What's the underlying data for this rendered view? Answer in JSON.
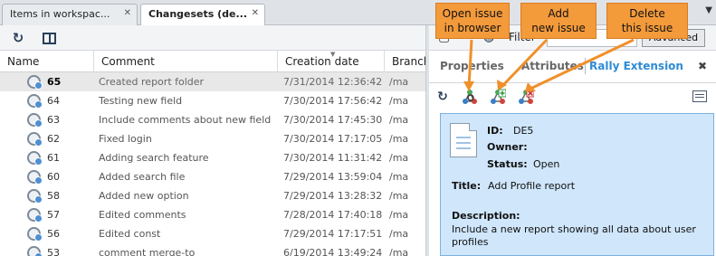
{
  "tabs": [
    {
      "label": "Items in workspac...",
      "close": "✕"
    },
    {
      "label": "Changesets (de...",
      "close": "✕"
    }
  ],
  "tabs_overflow_icon": "chevron-down-icon",
  "toolbar": {
    "refresh_icon": "refresh-icon",
    "panel_icon": "toggle-panel-icon"
  },
  "table": {
    "columns": [
      "Name",
      "Comment",
      "Creation date",
      "Branch"
    ],
    "rows": [
      {
        "id": "65",
        "comment": "Created report folder",
        "date": "7/31/2014 12:36:42",
        "branch": "/ma",
        "selected": true
      },
      {
        "id": "64",
        "comment": "Testing new field",
        "date": "7/30/2014 17:56:42",
        "branch": "/ma"
      },
      {
        "id": "63",
        "comment": "Include comments about new field",
        "date": "7/30/2014 17:45:30",
        "branch": "/ma"
      },
      {
        "id": "62",
        "comment": "Fixed login",
        "date": "7/30/2014 17:17:05",
        "branch": "/ma"
      },
      {
        "id": "61",
        "comment": "Adding search feature",
        "date": "7/30/2014 11:31:42",
        "branch": "/ma"
      },
      {
        "id": "60",
        "comment": "Added search file",
        "date": "7/29/2014 13:59:04",
        "branch": "/ma"
      },
      {
        "id": "58",
        "comment": "Added new option",
        "date": "7/29/2014 13:28:32",
        "branch": "/ma"
      },
      {
        "id": "57",
        "comment": "Edited comments",
        "date": "7/28/2014 17:40:18",
        "branch": "/ma"
      },
      {
        "id": "56",
        "comment": "Edited const",
        "date": "7/29/2014 17:17:51",
        "branch": "/ma"
      },
      {
        "id": "53",
        "comment": "comment merge-to",
        "date": "6/19/2014 13:49:24",
        "branch": "/ma"
      }
    ]
  },
  "right_panel": {
    "filter_label": "Filter",
    "filter_value": "",
    "advanced_label": "Advanced",
    "tabs": [
      "Properties",
      "Attributes",
      "Rally Extension"
    ],
    "active_tab": "Rally Extension",
    "close": "✖",
    "toolbar_icons": [
      "refresh-icon",
      "open-issue-in-browser-icon",
      "add-new-issue-icon",
      "delete-issue-icon",
      "list-view-icon"
    ],
    "issue": {
      "id_label": "ID:",
      "id_value": "DE5",
      "owner_label": "Owner:",
      "owner_value": "",
      "status_label": "Status:",
      "status_value": "Open",
      "title_label": "Title:",
      "title_value": "Add Profile report",
      "description_label": "Description:",
      "description_value": "Include a new report showing all data about user profiles"
    }
  },
  "callouts": [
    {
      "line1": "Open issue",
      "line2": "in browser"
    },
    {
      "line1": "Add",
      "line2": "new issue"
    },
    {
      "line1": "Delete",
      "line2": "this issue"
    }
  ],
  "colors": {
    "callout": "#f39a3b",
    "card_background": "#cfe6fb",
    "active_tab_text": "#2e8bd6",
    "selected_row": "#e8e8e8"
  }
}
